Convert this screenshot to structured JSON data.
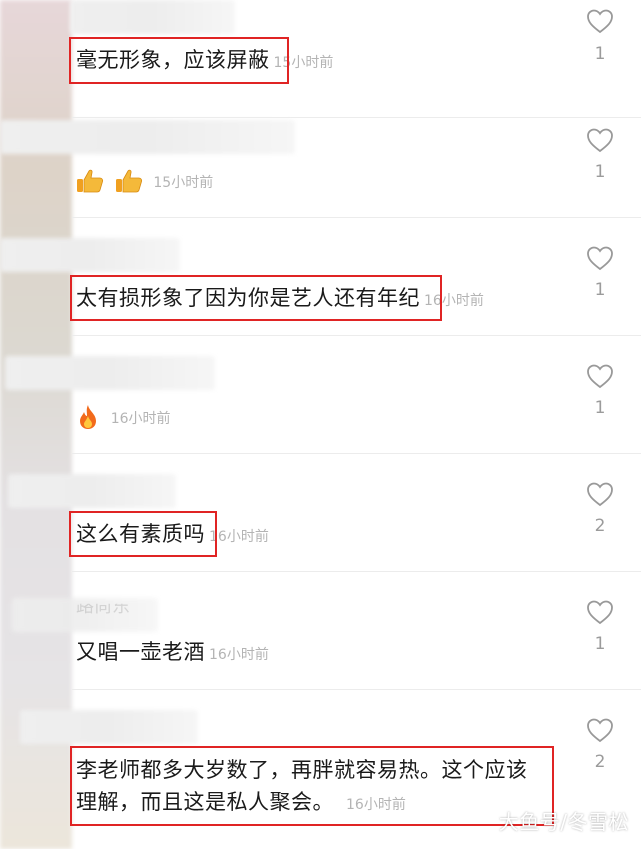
{
  "comments": [
    {
      "text": "毫无形象，应该屏蔽",
      "time": "15小时前",
      "likes": "1",
      "highlighted": true
    },
    {
      "text": "",
      "emojis": [
        "thumbs-up",
        "thumbs-up"
      ],
      "time": "15小时前",
      "likes": "1",
      "highlighted": false
    },
    {
      "text": "太有损形象了因为你是艺人还有年纪",
      "time": "16小时前",
      "likes": "1",
      "highlighted": true
    },
    {
      "text": "",
      "emojis": [
        "fire"
      ],
      "time": "16小时前",
      "likes": "1",
      "highlighted": false
    },
    {
      "text": "这么有素质吗",
      "time": "16小时前",
      "likes": "2",
      "highlighted": true
    },
    {
      "text": "又唱一壶老酒",
      "time": "16小时前",
      "likes": "1",
      "highlighted": false,
      "username_partial": "路尚东"
    },
    {
      "text_line1": "李老师都多大岁数了，再胖就容易热。这个应该",
      "text_line2": "理解，而且这是私人聚会。",
      "time": "16小时前",
      "likes": "2",
      "highlighted": true
    }
  ],
  "watermark": "大鱼号/冬雪松",
  "colors": {
    "highlight": "#e02424",
    "time": "#b4b4b4",
    "count": "#9b9b9b"
  }
}
